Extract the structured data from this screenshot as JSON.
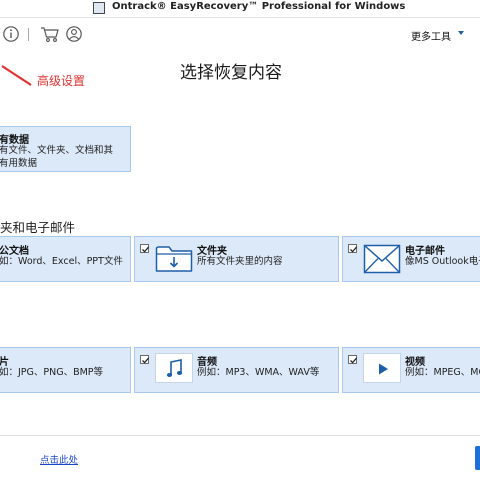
{
  "window": {
    "title": "Ontrack® EasyRecovery™ Professional for Windows"
  },
  "toolbar": {
    "more_tools": "更多工具"
  },
  "annotation": {
    "label": "高级设置"
  },
  "page": {
    "title": "选择恢复内容"
  },
  "all_data_card": {
    "title": "有数据",
    "line1": "有文件、文件夹、文档和其",
    "line2": "有用数据"
  },
  "section": {
    "heading": "夹和电子邮件"
  },
  "cards": {
    "office": {
      "title": "公文档",
      "desc": "如：Word、Excel、PPT文件"
    },
    "folder": {
      "title": "文件夹",
      "desc": "所有文件夹里的内容"
    },
    "email": {
      "title": "电子邮件",
      "desc": "像MS Outlook电子"
    },
    "photo": {
      "title": "片",
      "desc": "如：JPG、PNG、BMP等"
    },
    "audio": {
      "title": "音频",
      "desc": "例如：MP3、WMA、WAV等"
    },
    "video": {
      "title": "视频",
      "desc": "例如：MPEG、MO"
    }
  },
  "footer": {
    "link": "点击此处"
  },
  "colors": {
    "accent": "#1e6fd9",
    "card_bg": "#dce9f9",
    "card_border": "#a9c8ee",
    "annotation": "#e0312f",
    "link": "#1a46c9"
  },
  "icons": [
    "app-icon",
    "info-icon",
    "cart-icon",
    "user-icon",
    "chevron-down-icon",
    "folder-icon",
    "mail-icon",
    "music-icon",
    "play-icon",
    "checkbox-checked-icon"
  ]
}
